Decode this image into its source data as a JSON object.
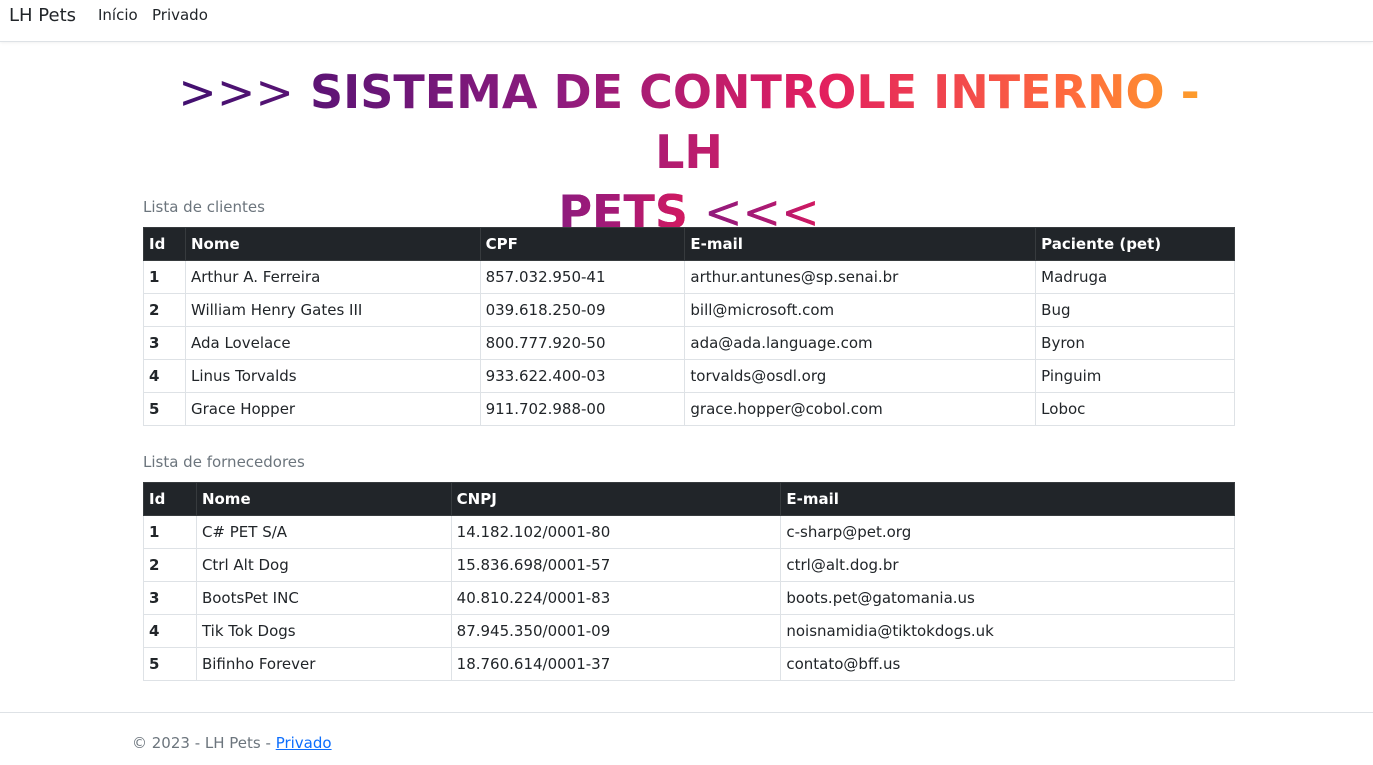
{
  "nav": {
    "brand": "LH Pets",
    "links": [
      "Início",
      "Privado"
    ]
  },
  "title": {
    "prefix": ">>>",
    "text": "SISTEMA DE CONTROLE INTERNO - LH",
    "text2": "PETS",
    "suffix": "<<<"
  },
  "clientes": {
    "caption": "Lista de clientes",
    "headers": [
      "Id",
      "Nome",
      "CPF",
      "E-mail",
      "Paciente (pet)"
    ],
    "rows": [
      [
        "1",
        "Arthur A. Ferreira",
        "857.032.950-41",
        "arthur.antunes@sp.senai.br",
        "Madruga"
      ],
      [
        "2",
        "William Henry Gates III",
        "039.618.250-09",
        "bill@microsoft.com",
        "Bug"
      ],
      [
        "3",
        "Ada Lovelace",
        "800.777.920-50",
        "ada@ada.language.com",
        "Byron"
      ],
      [
        "4",
        "Linus Torvalds",
        "933.622.400-03",
        "torvalds@osdl.org",
        "Pinguim"
      ],
      [
        "5",
        "Grace Hopper",
        "911.702.988-00",
        "grace.hopper@cobol.com",
        "Loboc"
      ]
    ]
  },
  "fornecedores": {
    "caption": "Lista de fornecedores",
    "headers": [
      "Id",
      "Nome",
      "CNPJ",
      "E-mail"
    ],
    "rows": [
      [
        "1",
        "C# PET S/A",
        "14.182.102/0001-80",
        "c-sharp@pet.org"
      ],
      [
        "2",
        "Ctrl Alt Dog",
        "15.836.698/0001-57",
        "ctrl@alt.dog.br"
      ],
      [
        "3",
        "BootsPet INC",
        "40.810.224/0001-83",
        "boots.pet@gatomania.us"
      ],
      [
        "4",
        "Tik Tok Dogs",
        "87.945.350/0001-09",
        "noisnamidia@tiktokdogs.uk"
      ],
      [
        "5",
        "Bifinho Forever",
        "18.760.614/0001-37",
        "contato@bff.us"
      ]
    ]
  },
  "footer": {
    "text": "© 2023 - LH Pets - ",
    "link": "Privado"
  }
}
